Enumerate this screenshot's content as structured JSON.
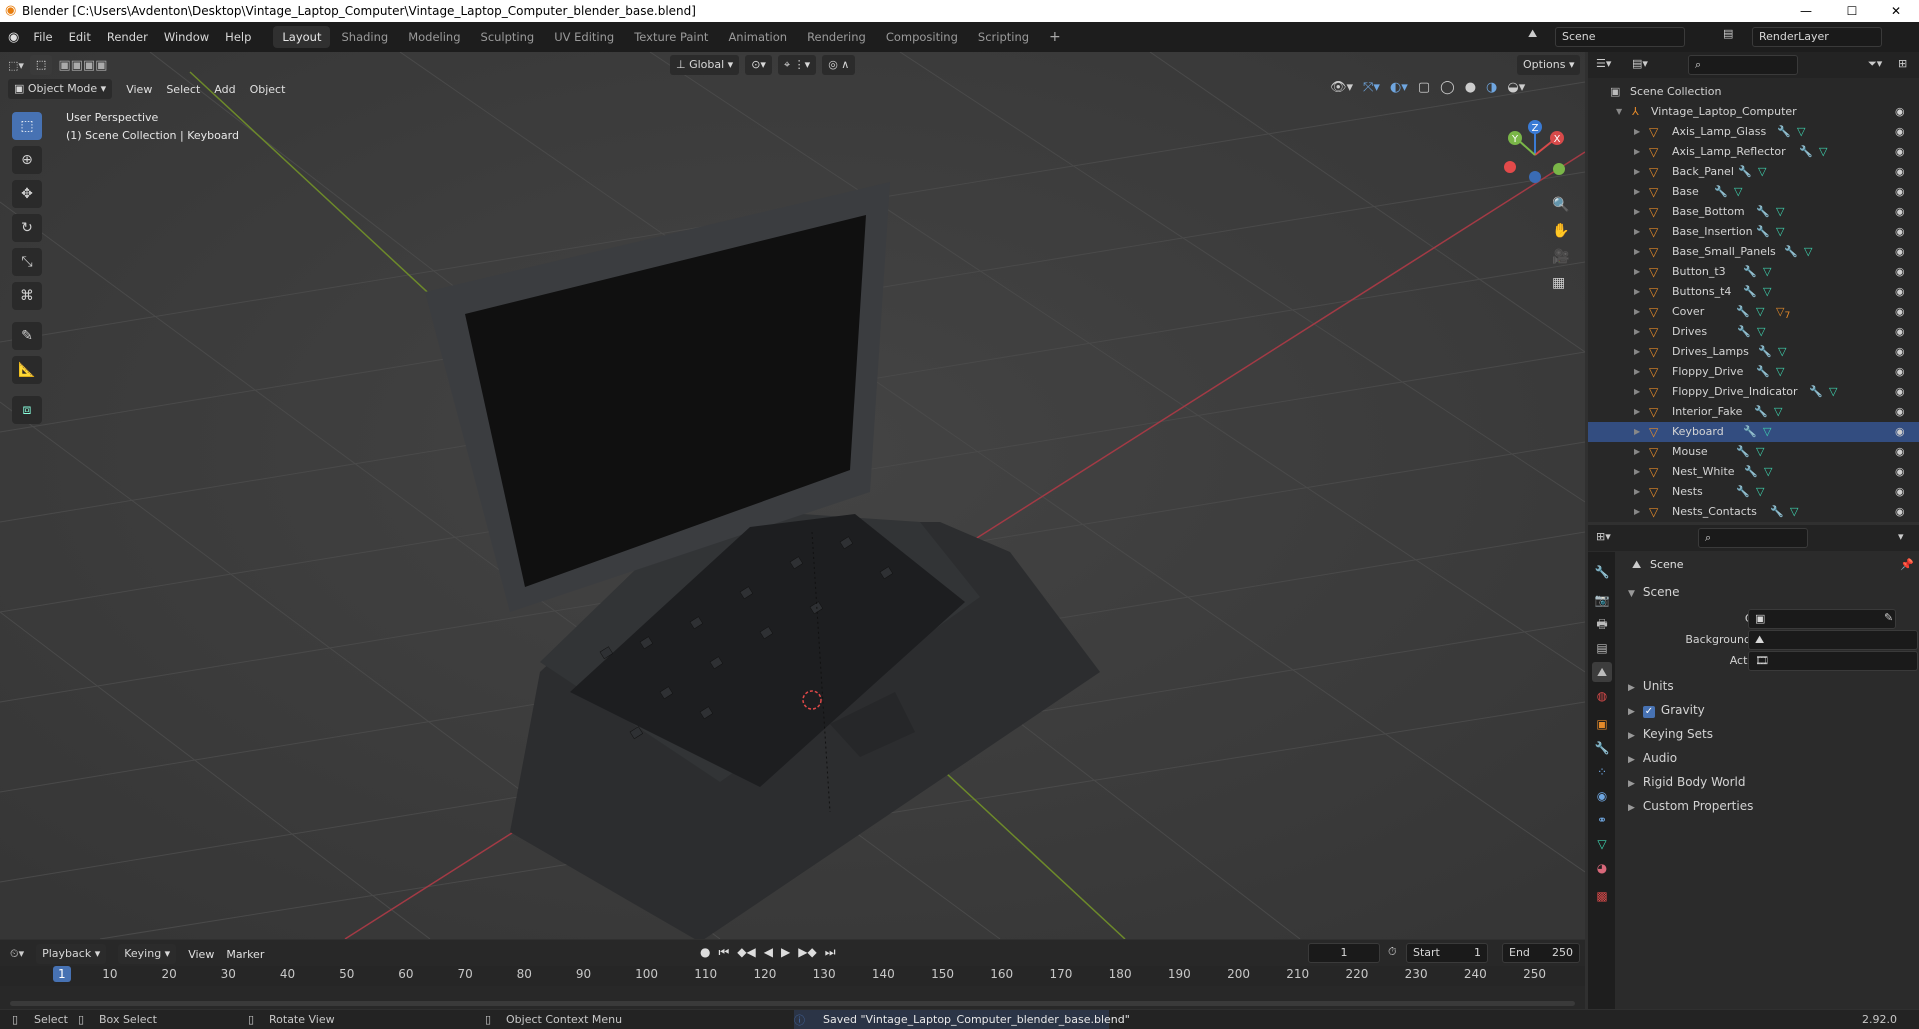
{
  "window": {
    "title": "Blender [C:\\Users\\Avdenton\\Desktop\\Vintage_Laptop_Computer\\Vintage_Laptop_Computer_blender_base.blend]",
    "minimize": "—",
    "maximize": "☐",
    "close": "✕"
  },
  "menus": [
    "File",
    "Edit",
    "Render",
    "Window",
    "Help"
  ],
  "workspace_tabs": [
    "Layout",
    "Shading",
    "Modeling",
    "Sculpting",
    "UV Editing",
    "Texture Paint",
    "Animation",
    "Rendering",
    "Compositing",
    "Scripting"
  ],
  "scene_name": "Scene",
  "view_layer": "RenderLayer",
  "viewport": {
    "transform_orientation": "Global",
    "options_label": "Options",
    "mode": "Object Mode",
    "menus": [
      "View",
      "Select",
      "Add",
      "Object"
    ],
    "perspective": "User Perspective",
    "collection_info": "(1) Scene Collection | Keyboard",
    "gizmo": {
      "x": "X",
      "y": "Y",
      "z": "Z"
    }
  },
  "outliner": {
    "scene_collection": "Scene Collection",
    "root": "Vintage_Laptop_Computer",
    "items": [
      {
        "name": "Axis_Lamp_Glass"
      },
      {
        "name": "Axis_Lamp_Reflector"
      },
      {
        "name": "Back_Panel"
      },
      {
        "name": "Base"
      },
      {
        "name": "Base_Bottom"
      },
      {
        "name": "Base_Insertion"
      },
      {
        "name": "Base_Small_Panels"
      },
      {
        "name": "Button_t3"
      },
      {
        "name": "Buttons_t4"
      },
      {
        "name": "Cover",
        "extra": "7"
      },
      {
        "name": "Drives"
      },
      {
        "name": "Drives_Lamps"
      },
      {
        "name": "Floppy_Drive"
      },
      {
        "name": "Floppy_Drive_Indicator"
      },
      {
        "name": "Interior_Fake"
      },
      {
        "name": "Keyboard"
      },
      {
        "name": "Mouse"
      },
      {
        "name": "Nest_White"
      },
      {
        "name": "Nests"
      },
      {
        "name": "Nests_Contacts"
      }
    ]
  },
  "properties": {
    "context": "Scene",
    "panel": "Scene",
    "fields": [
      {
        "label": "Camera"
      },
      {
        "label": "Background Scene"
      },
      {
        "label": "Active Clip"
      }
    ],
    "sections": [
      "Units",
      "Gravity",
      "Keying Sets",
      "Audio",
      "Rigid Body World",
      "Custom Properties"
    ],
    "gravity_checked": true
  },
  "timeline": {
    "menus": [
      "Playback",
      "Keying",
      "View",
      "Marker"
    ],
    "current_frame": "1",
    "start_label": "Start",
    "start": "1",
    "end_label": "End",
    "end": "250",
    "ticks": [
      "1",
      "10",
      "20",
      "30",
      "40",
      "50",
      "60",
      "70",
      "80",
      "90",
      "100",
      "110",
      "120",
      "130",
      "140",
      "150",
      "160",
      "170",
      "180",
      "190",
      "200",
      "210",
      "220",
      "230",
      "240",
      "250"
    ]
  },
  "statusbar": {
    "select": "Select",
    "box_select": "Box Select",
    "rotate_view": "Rotate View",
    "context_menu": "Object Context Menu",
    "message": "Saved \"Vintage_Laptop_Computer_blender_base.blend\"",
    "version": "2.92.0"
  }
}
